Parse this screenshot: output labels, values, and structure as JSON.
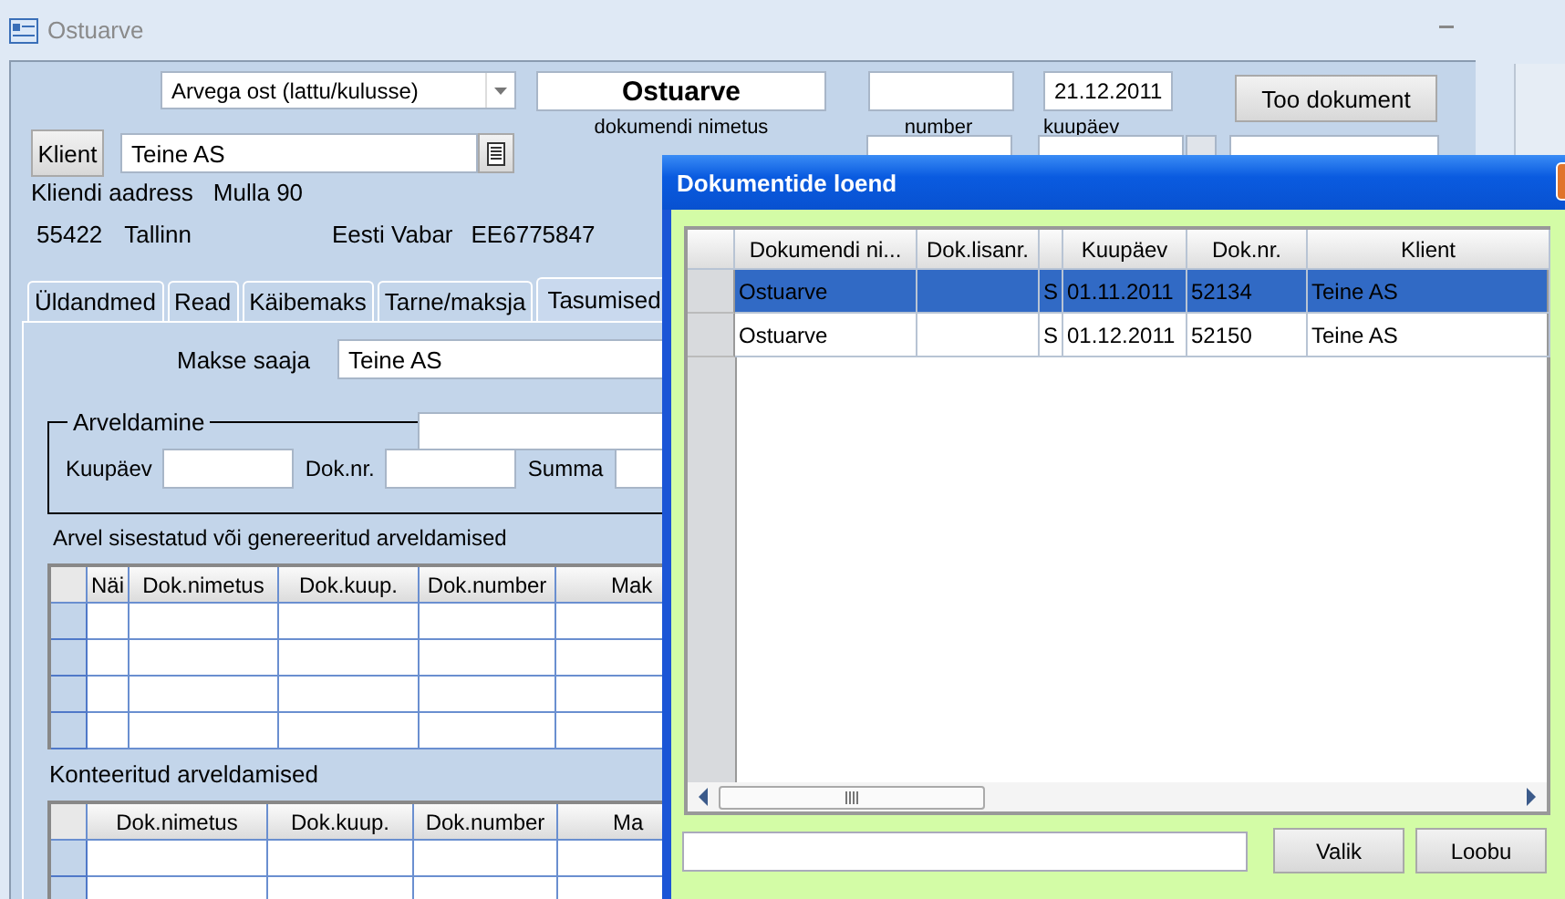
{
  "window": {
    "title": "Ostuarve"
  },
  "header": {
    "document_type": "Arvega ost (lattu/kulusse)",
    "document_name": "Ostuarve",
    "document_name_label": "dokumendi nimetus",
    "number_label": "number",
    "date": "21.12.2011",
    "date_label": "kuupäev",
    "fetch_button": "Too dokument"
  },
  "client": {
    "button": "Klient",
    "name": "Teine AS",
    "address_label": "Kliendi aadress",
    "street": "Mulla 90",
    "postal_code": "55422",
    "city": "Tallinn",
    "country": "Eesti Vabar",
    "reg_code": "EE6775847"
  },
  "tabs": [
    {
      "label": "Üldandmed",
      "selected": false
    },
    {
      "label": "Read",
      "selected": false
    },
    {
      "label": "Käibemaks",
      "selected": false
    },
    {
      "label": "Tarne/maksja",
      "selected": false
    },
    {
      "label": "Tasumised",
      "selected": true
    }
  ],
  "payment": {
    "payee_label": "Makse saaja",
    "payee": "Teine AS",
    "settlement": {
      "title": "Arveldamine",
      "fields": [
        {
          "label": "Kuupäev"
        },
        {
          "label": "Dok.nr."
        },
        {
          "label": "Summa"
        }
      ]
    },
    "entered": {
      "title": "Arvel sisestatud või genereeritud arveldamised",
      "columns": [
        "Näi",
        "Dok.nimetus",
        "Dok.kuup.",
        "Dok.number",
        "Mak"
      ]
    },
    "posted": {
      "title": "Konteeritud arveldamised",
      "columns": [
        "Dok.nimetus",
        "Dok.kuup.",
        "Dok.number",
        "Ma"
      ]
    }
  },
  "dialog": {
    "title": "Dokumentide loend",
    "columns": [
      "Dokumendi ni...",
      "Dok.lisanr.",
      "Kuupäev",
      "Dok.nr.",
      "Klient"
    ],
    "rows": [
      {
        "document": "Ostuarve",
        "flag": "S",
        "date": "01.11.2011",
        "number": "52134",
        "client": "Teine AS",
        "selected": true
      },
      {
        "document": "Ostuarve",
        "flag": "S",
        "date": "01.12.2011",
        "number": "52150",
        "client": "Teine AS",
        "selected": false
      }
    ],
    "buttons": [
      "Valik",
      "Loobu"
    ]
  }
}
